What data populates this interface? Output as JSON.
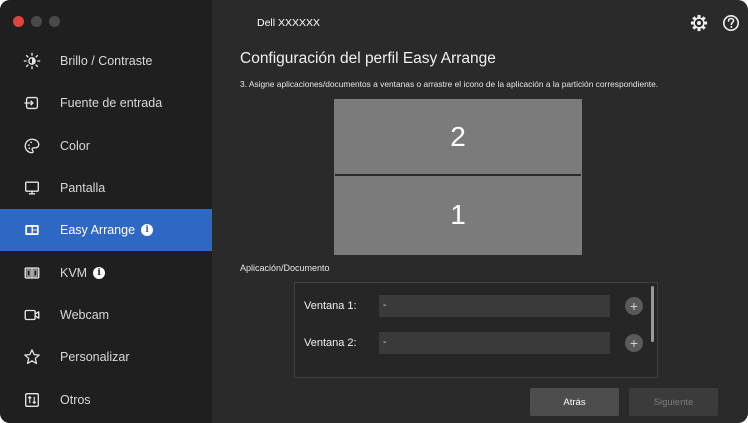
{
  "window": {
    "device_name": "Dell XXXXXX"
  },
  "sidebar": {
    "items": [
      {
        "label": "Brillo / Contraste",
        "icon": "brightness-icon"
      },
      {
        "label": "Fuente de entrada",
        "icon": "input-source-icon"
      },
      {
        "label": "Color",
        "icon": "color-palette-icon"
      },
      {
        "label": "Pantalla",
        "icon": "monitor-icon"
      },
      {
        "label": "Easy Arrange",
        "icon": "easy-arrange-icon",
        "active": true,
        "info": "i"
      },
      {
        "label": "KVM",
        "icon": "kvm-icon",
        "info": "i"
      },
      {
        "label": "Webcam",
        "icon": "webcam-icon"
      },
      {
        "label": "Personalizar",
        "icon": "star-icon"
      },
      {
        "label": "Otros",
        "icon": "others-icon"
      }
    ]
  },
  "main": {
    "title": "Configuración del perfil Easy Arrange",
    "instruction": "3. Asigne aplicaciones/documentos a ventanas o arrastre el icono de la aplicación a la partición correspondiente.",
    "partitions": [
      "2",
      "1"
    ],
    "app_doc_label": "Aplicación/Documento",
    "windows": [
      {
        "label": "Ventana 1:",
        "value": "-"
      },
      {
        "label": "Ventana 2:",
        "value": "-"
      }
    ],
    "add_symbol": "+",
    "buttons": {
      "back": "Atrás",
      "next": "Siguiente"
    }
  },
  "colors": {
    "accent": "#2f68c4",
    "background": "#2a2a2a",
    "sidebar": "#1f1f1f",
    "partition": "#7b7b7b"
  }
}
